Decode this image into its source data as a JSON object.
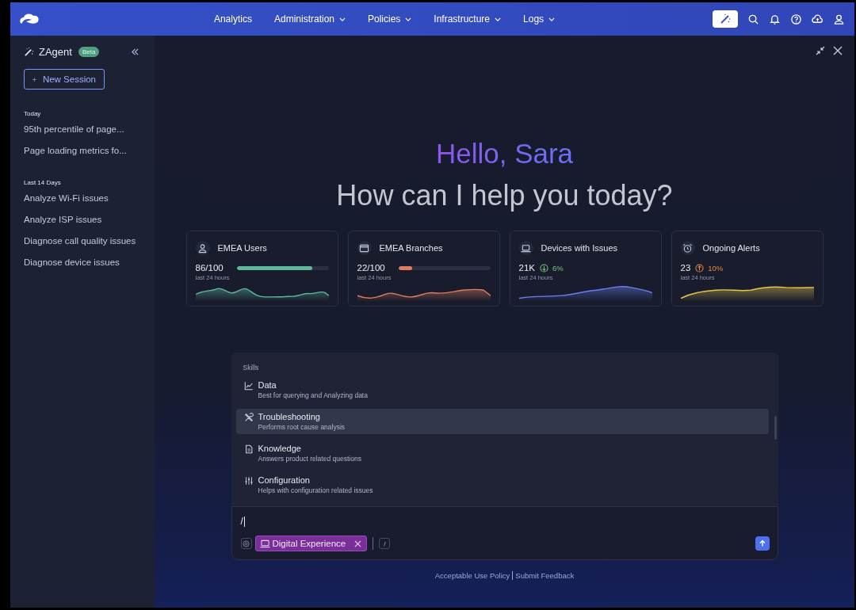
{
  "nav": {
    "items": [
      {
        "label": "Analytics",
        "dropdown": false
      },
      {
        "label": "Administration",
        "dropdown": true
      },
      {
        "label": "Policies",
        "dropdown": true
      },
      {
        "label": "Infrastructure",
        "dropdown": true
      },
      {
        "label": "Logs",
        "dropdown": true
      }
    ]
  },
  "sidebar": {
    "title": "ZAgent",
    "badge": "Beta",
    "new_session": "New Session",
    "sections": [
      {
        "heading": "Today",
        "items": [
          "95th percentile of page...",
          "Page loading metrics fo..."
        ]
      },
      {
        "heading": "Last 14 Days",
        "items": [
          "Analyze Wi-Fi issues",
          "Analyze ISP issues",
          "Diagnose call quality issues",
          "Diagnose device issues"
        ]
      }
    ]
  },
  "greeting": "Hello, Sara",
  "question": "How can I help you today?",
  "cards": [
    {
      "title": "EMEA Users",
      "value": "86/100",
      "kind": "progress",
      "level": 0.82,
      "color": "#5fb898",
      "caption": "last 24 hours"
    },
    {
      "title": "EMEA Branches",
      "value": "22/100",
      "kind": "progress",
      "level": 0.15,
      "color": "#e07b5f",
      "caption": "last 24 hours"
    },
    {
      "title": "Devices with Issues",
      "value": "21K",
      "kind": "trend",
      "rising": false,
      "change": "6%",
      "color": "#6b7ff0",
      "caption": "last 24 hours"
    },
    {
      "title": "Ongoing Alerts",
      "value": "23",
      "kind": "trend",
      "rising": true,
      "change": "10%",
      "color": "#e8c547",
      "caption": "last 24 hours"
    }
  ],
  "skills": {
    "heading": "Skills",
    "items": [
      {
        "name": "Data",
        "description": "Best for querying and Analyzing data",
        "selected": false
      },
      {
        "name": "Troubleshooting",
        "description": "Performs root cause analysis",
        "selected": true
      },
      {
        "name": "Knowledge",
        "description": "Answers product related questions",
        "selected": false
      },
      {
        "name": "Configuration",
        "description": "Helps with configuration related issues",
        "selected": false
      }
    ]
  },
  "composer": {
    "value": "/",
    "chip": "Digital Experience"
  },
  "footer": {
    "links": [
      "Acceptable Use Policy",
      "Submit Feedback"
    ]
  }
}
